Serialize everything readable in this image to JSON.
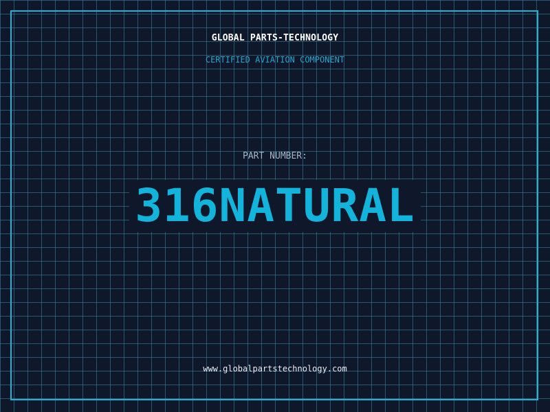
{
  "header": {
    "company": "GLOBAL PARTS-TECHNOLOGY",
    "subtitle": "CERTIFIED AVIATION COMPONENT"
  },
  "part": {
    "label": "PART NUMBER:",
    "number": "316NATURAL"
  },
  "footer": {
    "url": "www.globalpartstechnology.com"
  },
  "colors": {
    "background": "#0f172a",
    "accent": "#13b4dc",
    "frame": "#1fb3d6",
    "grid": "#388ca5"
  }
}
